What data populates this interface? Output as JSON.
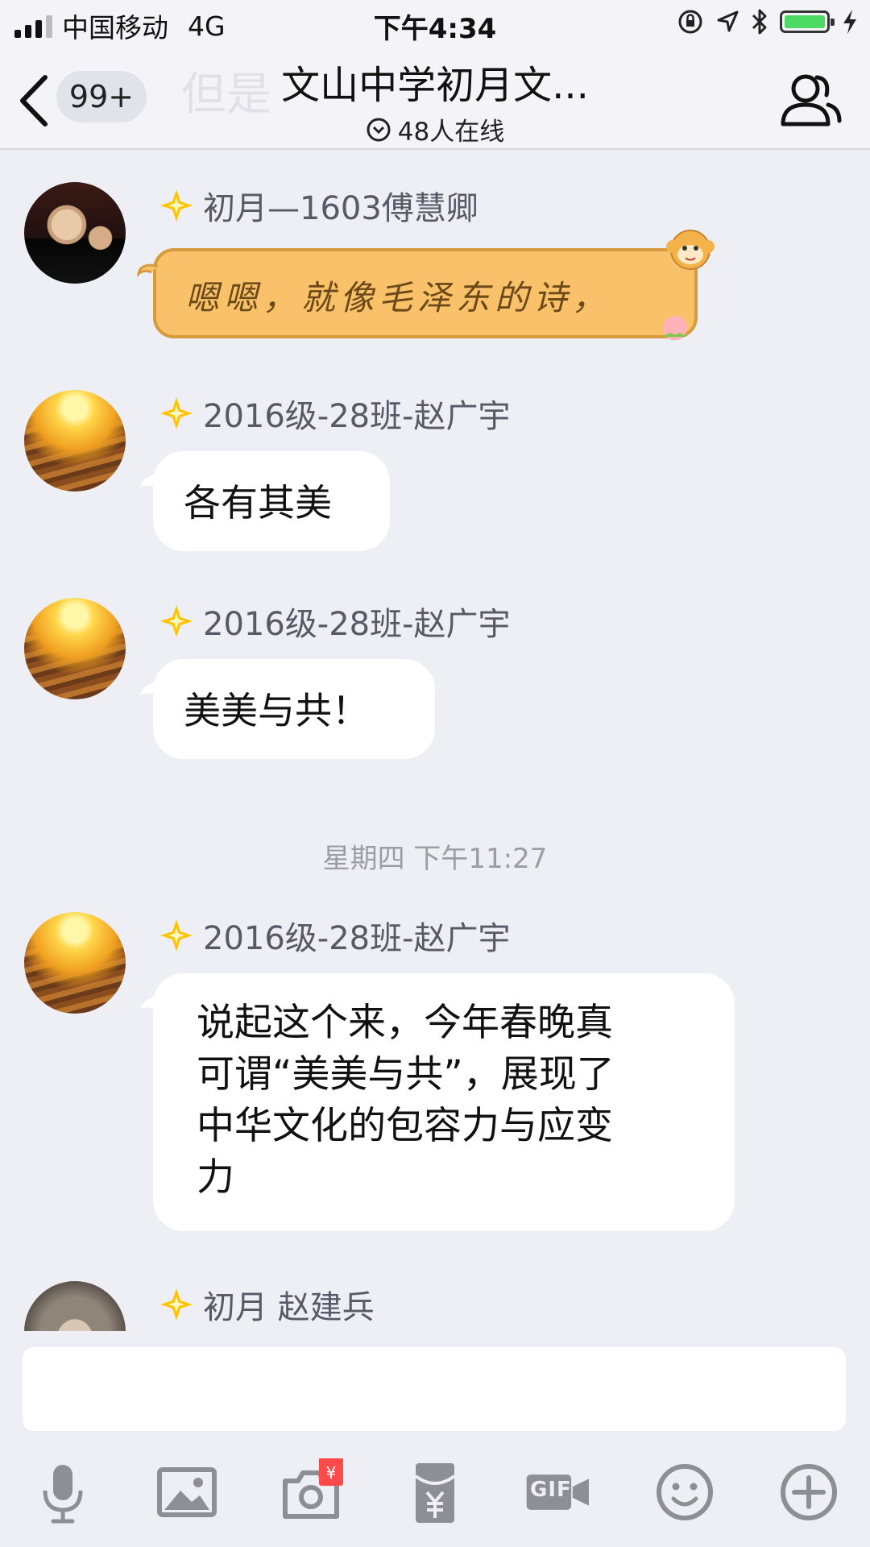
{
  "status_bar": {
    "carrier": "中国移动",
    "network": "4G",
    "time": "下午4:34",
    "battery_color": "#4cd964"
  },
  "nav": {
    "unread_count": "99+",
    "ghost_preview": "但是",
    "title": "文山中学初月文...",
    "online_status": "48人在线",
    "icons": [
      "back-chevron-icon",
      "online-circle-chevron-icon",
      "group-members-icon"
    ]
  },
  "messages": [
    {
      "sender": "初月—1603傅慧卿",
      "text": "嗯嗯，就像毛泽东的诗，",
      "style": "special-bubble"
    },
    {
      "sender": "2016级-28班-赵广宇",
      "text": "各有其美"
    },
    {
      "sender": "2016级-28班-赵广宇",
      "text": "美美与共！"
    },
    {
      "timestamp": "星期四 下午11:27"
    },
    {
      "sender": "2016级-28班-赵广宇",
      "text_lines": [
        "说起这个来，今年春晚真",
        "可谓“美美与共”，展现了",
        "中华文化的包容力与应变",
        "力"
      ]
    },
    {
      "sender": "初月 赵建兵"
    }
  ],
  "toolbar": {
    "icons": [
      "microphone-icon",
      "image-icon",
      "camera-redpacket-icon",
      "red-envelope-icon",
      "gif-icon",
      "emoji-icon",
      "plus-icon"
    ],
    "gif_label": "GIF",
    "redpacket_badge": "¥"
  },
  "colors": {
    "background": "#eeeff5",
    "bubble": "#ffffff",
    "special_bubble": "#f8c16a",
    "badge_star": "#ffc400"
  }
}
